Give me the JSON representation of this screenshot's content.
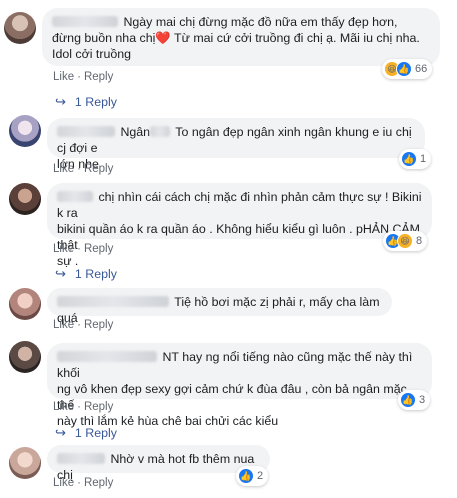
{
  "actions": {
    "like": "Like",
    "reply": "Reply",
    "dot": "·"
  },
  "comments": [
    {
      "line1": "Ngày mai chị đừng mặc đồ nữa em thấy đẹp hơn,",
      "line2": "đừng buồn nha chị",
      "line2_emoji": "❤️",
      "line2_rest": " Từ mai cứ cởi truồng đi chị ạ. Mãi iu chị nha.",
      "line3": "Idol cởi truồng",
      "reaction_count": "66",
      "replies": "1 Reply"
    },
    {
      "line1_prefix": "Ngân",
      "line1": " To ngân đẹp ngân xinh ngân khung e iu chị cj đợi e",
      "line2": "lớn nhe",
      "reaction_count": "1"
    },
    {
      "line1": "chị nhìn cái cách chị mặc đi nhìn phản cảm thực sự ! Bikini k ra",
      "line2": "bikini quần áo k ra quần áo . Không hiểu kiểu gì luôn . pHẢN CẢM thật",
      "line3": "sự .",
      "reaction_count": "8",
      "replies": "1 Reply"
    },
    {
      "line1": "Tiệ hồ bơi mặc zị phải r, mấy cha làm quá"
    },
    {
      "line1": "NT hay ng nổi tiếng nào cũng mặc thế này thì khối",
      "line2": "ng vô khen đẹp sexy gợi cảm chứ k đùa đâu , còn bả ngân mặc thế",
      "line3": "này thì lắm kẻ hùa chê bai chửi các kiểu",
      "reaction_count": "3",
      "replies": "1 Reply"
    },
    {
      "line1": "Nhờ v mà hot fb thêm nua chị",
      "reaction_count": "2"
    }
  ],
  "colors": {
    "bubble": "#f2f3f5",
    "link": "#385898",
    "meta": "#606770",
    "like": "#1877f2"
  }
}
